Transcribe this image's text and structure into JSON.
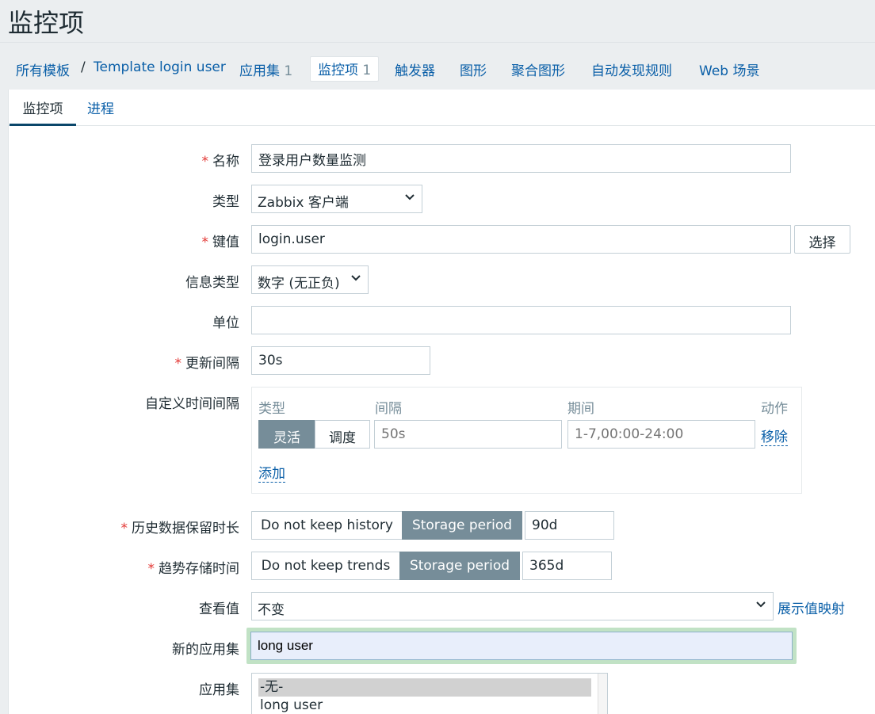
{
  "page": {
    "title": "监控项"
  },
  "nav": {
    "all_templates": "所有模板",
    "separator": "/",
    "template_name": "Template login user",
    "applications": "应用集",
    "applications_count": "1",
    "items": "监控项",
    "items_count": "1",
    "triggers": "触发器",
    "graphs": "图形",
    "screens": "聚合图形",
    "discovery": "自动发现规则",
    "web": "Web 场景"
  },
  "tabs": {
    "item": "监控项",
    "process": "进程"
  },
  "form": {
    "name": {
      "label": "名称",
      "value": "登录用户数量监测"
    },
    "type": {
      "label": "类型",
      "value": "Zabbix 客户端"
    },
    "key": {
      "label": "键值",
      "value": "login.user",
      "select_button": "选择"
    },
    "info_type": {
      "label": "信息类型",
      "value": "数字 (无正负)"
    },
    "units": {
      "label": "单位",
      "value": ""
    },
    "update_interval": {
      "label": "更新间隔",
      "value": "30s"
    },
    "custom_intervals": {
      "label": "自定义时间间隔",
      "col_type": "类型",
      "col_interval": "间隔",
      "col_period": "期间",
      "col_action": "动作",
      "flexible": "灵活",
      "scheduling": "调度",
      "interval_placeholder": "50s",
      "period_placeholder": "1-7,00:00-24:00",
      "remove": "移除",
      "add": "添加"
    },
    "history": {
      "label": "历史数据保留时长",
      "off": "Do not keep history",
      "on": "Storage period",
      "value": "90d"
    },
    "trends": {
      "label": "趋势存储时间",
      "off": "Do not keep trends",
      "on": "Storage period",
      "value": "365d"
    },
    "show_value": {
      "label": "查看值",
      "value": "不变",
      "mapping_link": "展示值映射"
    },
    "new_application": {
      "label": "新的应用集",
      "value": "long user"
    },
    "applications": {
      "label": "应用集",
      "options": [
        "-无-",
        "long user"
      ]
    }
  },
  "colors": {
    "accent": "#0a5fa8",
    "required": "#e33734",
    "segment_active": "#768d99",
    "focus_ring": "#c1e2c5"
  }
}
